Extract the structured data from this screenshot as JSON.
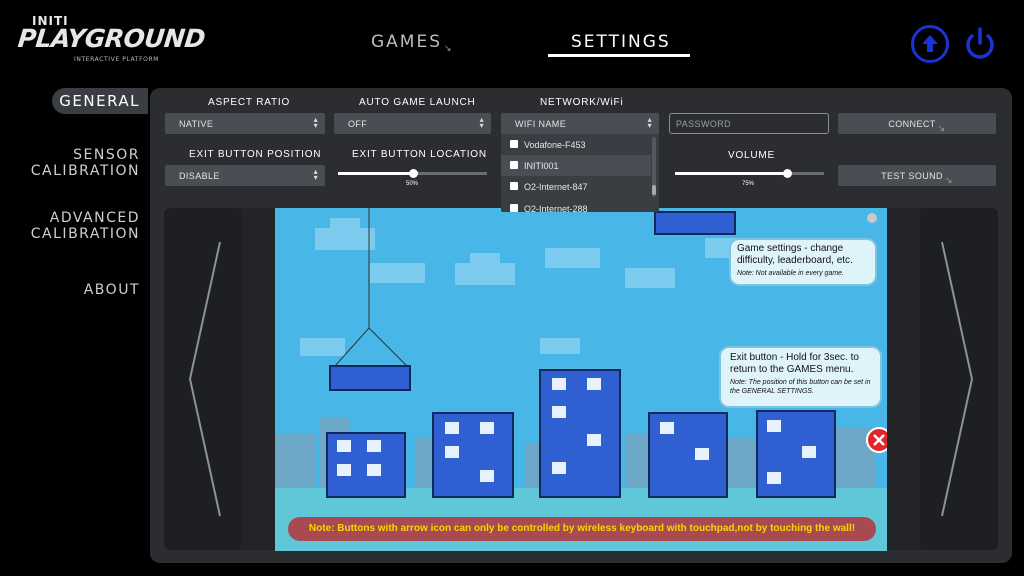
{
  "logo": {
    "brand_small": "INITI",
    "brand_main": "PLAYGROUND",
    "brand_sub": "INTERACTIVE PLATFORM"
  },
  "top_nav": {
    "games": "GAMES",
    "settings": "SETTINGS",
    "active": "SETTINGS"
  },
  "top_buttons": {
    "update_icon": "upload-circle-icon",
    "power_icon": "power-icon",
    "color": "#1b33d6"
  },
  "side_nav": {
    "items": [
      {
        "label": "GENERAL",
        "active": true
      },
      {
        "label_line1": "SENSOR",
        "label_line2": "CALIBRATION"
      },
      {
        "label_line1": "ADVANCED",
        "label_line2": "CALIBRATION"
      },
      {
        "label": "ABOUT"
      }
    ]
  },
  "settings": {
    "aspect_ratio": {
      "label": "ASPECT RATIO",
      "value": "NATIVE"
    },
    "auto_game_launch": {
      "label": "AUTO GAME LAUNCH",
      "value": "OFF"
    },
    "network": {
      "label": "NETWORK/WiFi",
      "value": "WIFI NAME",
      "networks": [
        "Vodafone-F453",
        "INITI001",
        "O2-Internet-847",
        "O2-Internet-288"
      ],
      "password_placeholder": "PASSWORD",
      "connect_label": "CONNECT"
    },
    "exit_button_position": {
      "label": "EXIT BUTTON POSITION",
      "value": "DISABLE"
    },
    "exit_button_location": {
      "label": "EXIT BUTTON LOCATION",
      "value": 0.5,
      "value_text": "50%"
    },
    "volume": {
      "label": "VOLUME",
      "value": 0.75,
      "value_text": "75%",
      "test_label": "TEST SOUND"
    }
  },
  "preview": {
    "tooltip_game_settings": {
      "title": "Game settings - change difficulty, leaderboard, etc.",
      "note": "Note: Not available in every game."
    },
    "tooltip_exit": {
      "title": "Exit button - Hold for 3sec. to return to the GAMES menu.",
      "note": "Note: The position of this button can be set in the GENERAL SETTINGS."
    },
    "note_bar": "Note: Buttons with arrow icon  can only be controlled by wireless keyboard with touchpad,not by touching the wall!"
  }
}
